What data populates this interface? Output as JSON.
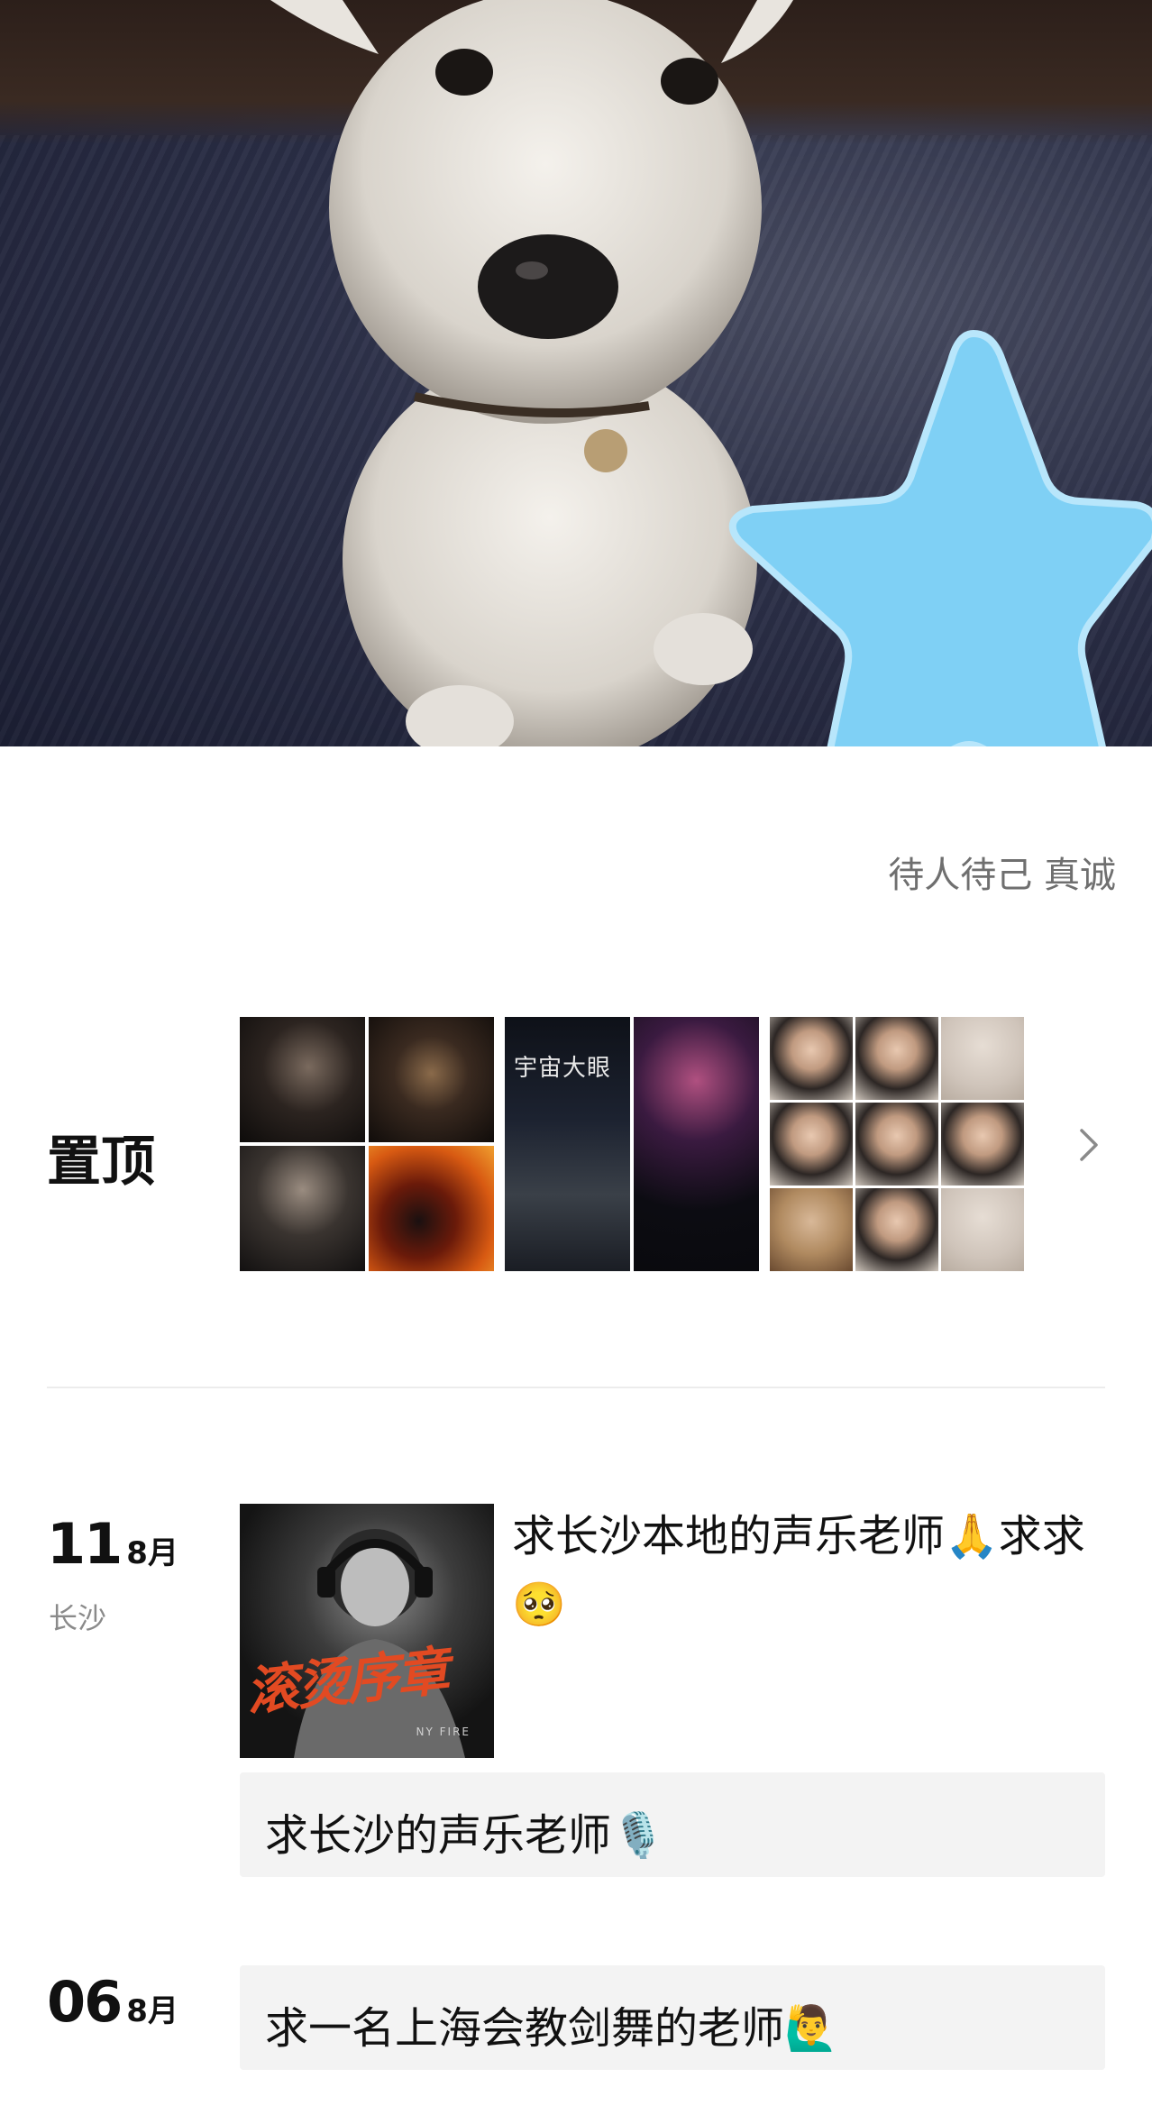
{
  "profile": {
    "signature": "待人待己 真诚"
  },
  "pinned": {
    "label": "置顶",
    "album_poster_text": "宇宙大眼"
  },
  "posts": [
    {
      "day": "11",
      "month": "8月",
      "location": "长沙",
      "image_title": "滚烫序章",
      "image_subtitle": "NY FIRE",
      "text": "求长沙本地的声乐老师🙏求求🥺",
      "repost_text": "求长沙的声乐老师🎙️"
    },
    {
      "day": "06",
      "month": "8月",
      "repost_text": "求一名上海会教剑舞的老师🙋‍♂️"
    }
  ],
  "colors": {
    "star": "#7fd0f5",
    "accent_title": "#e24a22",
    "muted": "#8a8a8a"
  }
}
